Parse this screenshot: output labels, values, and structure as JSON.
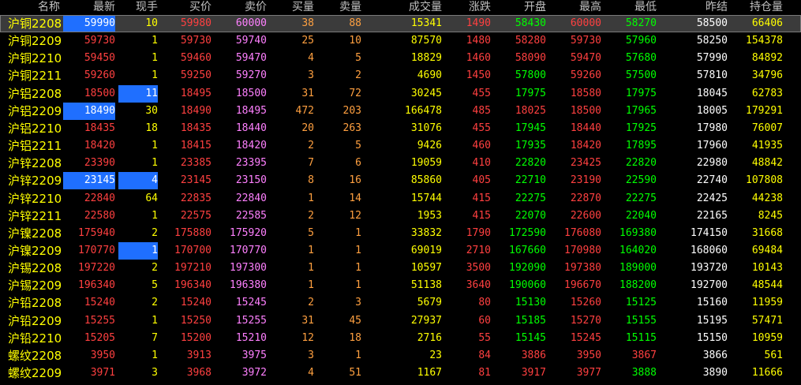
{
  "headers": [
    "名称",
    "最新",
    "现手",
    "买价",
    "卖价",
    "买量",
    "卖量",
    "成交量",
    "涨跌",
    "开盘",
    "最高",
    "最低",
    "昨结",
    "持仓量"
  ],
  "colors": {
    "yellow": "#ffff00",
    "red": "#ff4040",
    "green": "#00ff00",
    "white": "#ffffff",
    "pink": "#ff80ff",
    "orange": "#ffa040",
    "highlight": "#1f6fff"
  },
  "selected_row": 0,
  "rows": [
    [
      "沪铜2208",
      "59990",
      "10",
      "59980",
      "60000",
      "38",
      "88",
      "15341",
      "1490",
      "58430",
      "60000",
      "58270",
      "58500",
      "66406"
    ],
    [
      "沪铜2209",
      "59730",
      "1",
      "59730",
      "59740",
      "25",
      "10",
      "87570",
      "1480",
      "58280",
      "59730",
      "57960",
      "58250",
      "154378"
    ],
    [
      "沪铜2210",
      "59450",
      "1",
      "59460",
      "59470",
      "4",
      "5",
      "18829",
      "1460",
      "58090",
      "59470",
      "57680",
      "57990",
      "84892"
    ],
    [
      "沪铜2211",
      "59260",
      "1",
      "59250",
      "59270",
      "3",
      "2",
      "4690",
      "1450",
      "57800",
      "59260",
      "57500",
      "57810",
      "34796"
    ],
    [
      "沪铝2208",
      "18500",
      "11",
      "18495",
      "18500",
      "31",
      "72",
      "30245",
      "455",
      "17975",
      "18580",
      "17975",
      "18045",
      "62783"
    ],
    [
      "沪铝2209",
      "18490",
      "30",
      "18490",
      "18495",
      "472",
      "203",
      "166478",
      "485",
      "18025",
      "18500",
      "17965",
      "18005",
      "179291"
    ],
    [
      "沪铝2210",
      "18435",
      "18",
      "18435",
      "18440",
      "20",
      "263",
      "31076",
      "455",
      "17945",
      "18440",
      "17925",
      "17980",
      "76007"
    ],
    [
      "沪铝2211",
      "18420",
      "1",
      "18415",
      "18420",
      "2",
      "5",
      "9426",
      "460",
      "17935",
      "18420",
      "17895",
      "17960",
      "41935"
    ],
    [
      "沪锌2208",
      "23390",
      "1",
      "23385",
      "23395",
      "7",
      "6",
      "19059",
      "410",
      "22820",
      "23425",
      "22820",
      "22980",
      "48842"
    ],
    [
      "沪锌2209",
      "23145",
      "4",
      "23145",
      "23150",
      "8",
      "16",
      "85860",
      "405",
      "22710",
      "23190",
      "22590",
      "22740",
      "107808"
    ],
    [
      "沪锌2210",
      "22840",
      "64",
      "22835",
      "22840",
      "1",
      "14",
      "15744",
      "415",
      "22275",
      "22870",
      "22275",
      "22425",
      "44238"
    ],
    [
      "沪锌2211",
      "22580",
      "1",
      "22575",
      "22585",
      "2",
      "12",
      "1953",
      "415",
      "22070",
      "22600",
      "22040",
      "22165",
      "8245"
    ],
    [
      "沪镍2208",
      "175940",
      "2",
      "175880",
      "175920",
      "5",
      "1",
      "33832",
      "1790",
      "172590",
      "176080",
      "169380",
      "174150",
      "31668"
    ],
    [
      "沪镍2209",
      "170770",
      "1",
      "170700",
      "170770",
      "1",
      "1",
      "69019",
      "2710",
      "167660",
      "170980",
      "164020",
      "168060",
      "69484"
    ],
    [
      "沪锡2208",
      "197220",
      "2",
      "197210",
      "197300",
      "1",
      "1",
      "10597",
      "3500",
      "192090",
      "197380",
      "189000",
      "193720",
      "10143"
    ],
    [
      "沪锡2209",
      "196340",
      "5",
      "196340",
      "196380",
      "1",
      "1",
      "51138",
      "3640",
      "190060",
      "196670",
      "188200",
      "192700",
      "48544"
    ],
    [
      "沪铅2208",
      "15240",
      "2",
      "15240",
      "15245",
      "2",
      "3",
      "5679",
      "80",
      "15130",
      "15260",
      "15125",
      "15160",
      "11959"
    ],
    [
      "沪铅2209",
      "15255",
      "1",
      "15250",
      "15255",
      "31",
      "45",
      "27937",
      "60",
      "15185",
      "15270",
      "15155",
      "15195",
      "57471"
    ],
    [
      "沪铅2210",
      "15205",
      "7",
      "15200",
      "15210",
      "12",
      "18",
      "2716",
      "55",
      "15145",
      "15245",
      "15115",
      "15150",
      "10959"
    ],
    [
      "螺纹2208",
      "3950",
      "1",
      "3913",
      "3975",
      "3",
      "1",
      "23",
      "84",
      "3886",
      "3950",
      "3867",
      "3866",
      "561"
    ],
    [
      "螺纹2209",
      "3971",
      "3",
      "3968",
      "3972",
      "4",
      "51",
      "1167",
      "81",
      "3917",
      "3977",
      "3888",
      "3890",
      "11666"
    ]
  ],
  "highlights": [
    [
      0,
      1
    ],
    [
      4,
      2
    ],
    [
      5,
      1
    ],
    [
      9,
      1
    ],
    [
      9,
      2
    ],
    [
      13,
      2
    ]
  ]
}
